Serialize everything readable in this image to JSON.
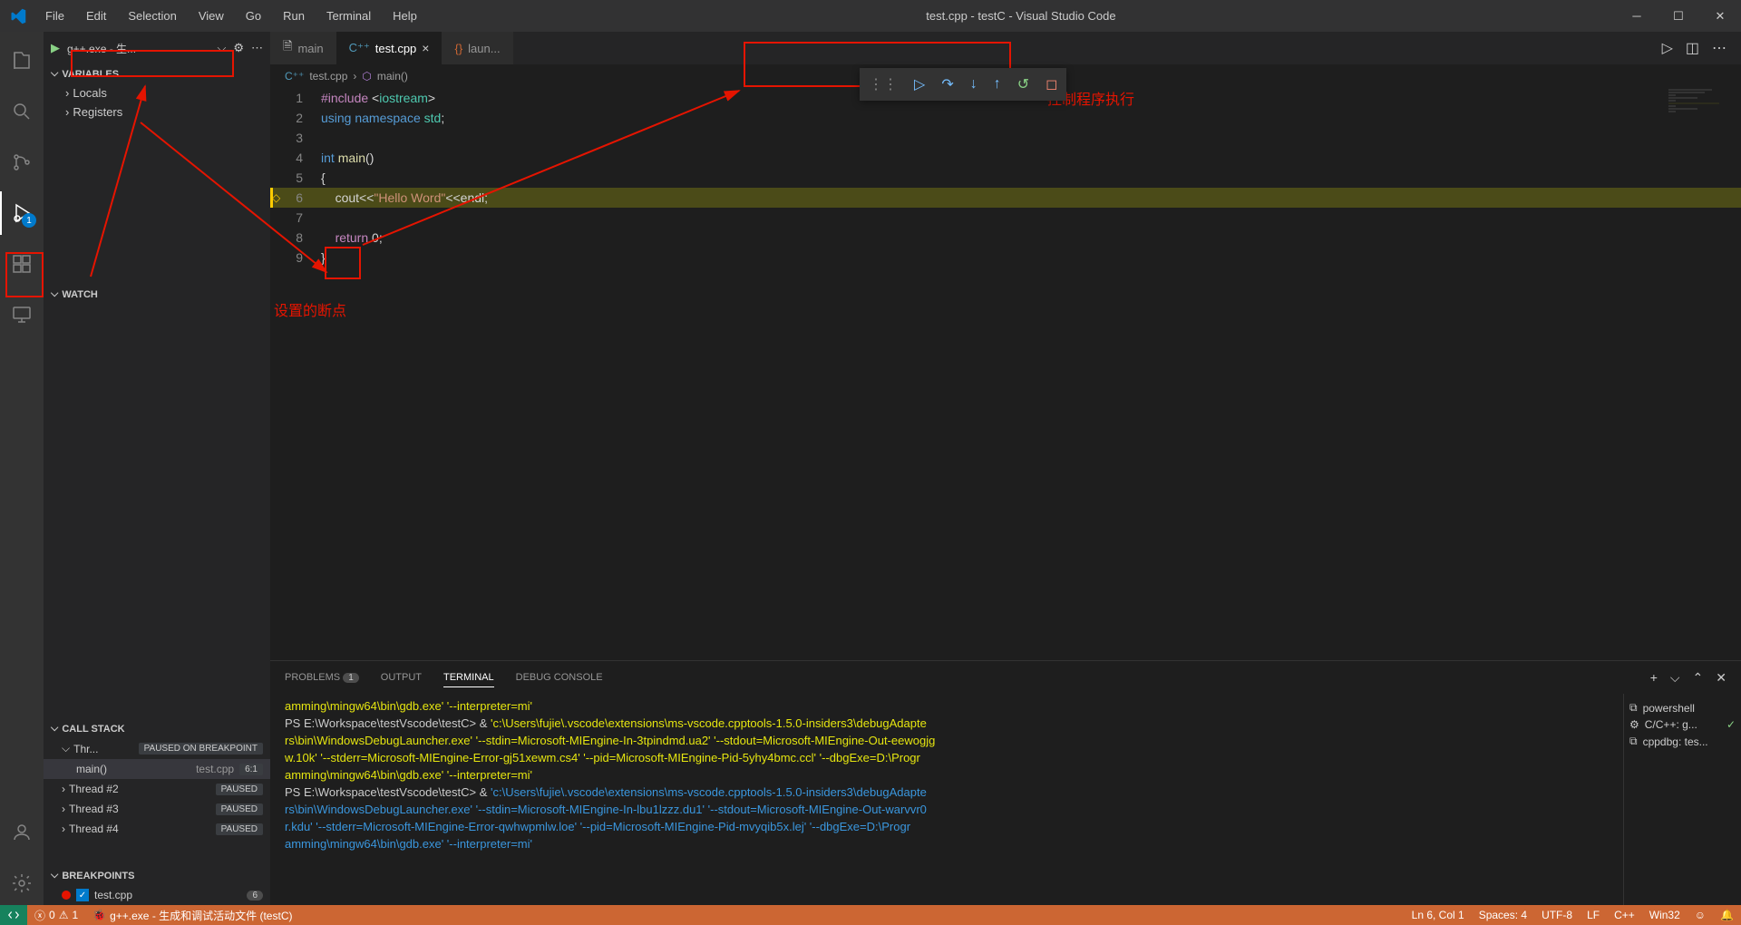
{
  "title": "test.cpp - testC - Visual Studio Code",
  "menu": [
    "File",
    "Edit",
    "Selection",
    "View",
    "Go",
    "Run",
    "Terminal",
    "Help"
  ],
  "runConfig": "g++.exe - 生...",
  "sidebar": {
    "variables": {
      "header": "VARIABLES",
      "items": [
        "Locals",
        "Registers"
      ]
    },
    "watch": {
      "header": "WATCH"
    },
    "callstack": {
      "header": "CALL STACK",
      "threadMain": "Thr...",
      "pausedOn": "PAUSED ON BREAKPOINT",
      "frame": {
        "fn": "main()",
        "file": "test.cpp",
        "pos": "6:1"
      },
      "threads": [
        {
          "name": "Thread #2",
          "state": "PAUSED"
        },
        {
          "name": "Thread #3",
          "state": "PAUSED"
        },
        {
          "name": "Thread #4",
          "state": "PAUSED"
        }
      ]
    },
    "breakpoints": {
      "header": "BREAKPOINTS",
      "items": [
        {
          "file": "test.cpp",
          "count": "6"
        }
      ]
    }
  },
  "tabs": [
    {
      "label": "main",
      "active": false
    },
    {
      "label": "test.cpp",
      "active": true
    },
    {
      "label": "laun...",
      "active": false
    }
  ],
  "breadcrumb": {
    "file": "test.cpp",
    "symbol": "main()"
  },
  "code": {
    "lines": [
      {
        "n": "1",
        "html": "<span class='k-pink'>#include</span> <span class='k-white'>&lt;</span><span class='k-green'>iostream</span><span class='k-white'>&gt;</span>"
      },
      {
        "n": "2",
        "html": "<span class='k-blue'>using</span> <span class='k-blue'>namespace</span> <span class='k-green'>std</span><span class='k-white'>;</span>"
      },
      {
        "n": "3",
        "html": ""
      },
      {
        "n": "4",
        "html": "<span class='k-blue'>int</span> <span class='k-fn'>main</span><span class='k-white'>()</span>"
      },
      {
        "n": "5",
        "html": "<span class='k-white'>{</span>"
      },
      {
        "n": "6",
        "html": "    <span class='k-white'>cout&lt;&lt;</span><span class='k-str'>\"Hello Word\"</span><span class='k-white'>&lt;&lt;endl;</span>",
        "hl": true,
        "bp": true
      },
      {
        "n": "7",
        "html": ""
      },
      {
        "n": "8",
        "html": "    <span class='k-pink'>return</span> <span class='k-white'>0;</span>"
      },
      {
        "n": "9",
        "html": "<span class='k-white'>}</span>"
      }
    ]
  },
  "panel": {
    "tabs": {
      "problems": "PROBLEMS",
      "problemsCount": "1",
      "output": "OUTPUT",
      "terminal": "TERMINAL",
      "debug": "DEBUG CONSOLE"
    },
    "terminal": {
      "lines": [
        {
          "cls": "t-yellow",
          "text": "amming\\mingw64\\bin\\gdb.exe' '--interpreter=mi'"
        },
        {
          "cls": "t-white",
          "text": "PS E:\\Workspace\\testVscode\\testC>  & <span class='t-yellow'>'c:\\Users\\fujie\\.vscode\\extensions\\ms-vscode.cpptools-1.5.0-insiders3\\debugAdapte</span>"
        },
        {
          "cls": "t-yellow",
          "text": "rs\\bin\\WindowsDebugLauncher.exe' '--stdin=Microsoft-MIEngine-In-3tpindmd.ua2' '--stdout=Microsoft-MIEngine-Out-eewogjg"
        },
        {
          "cls": "t-yellow",
          "text": "w.10k' '--stderr=Microsoft-MIEngine-Error-gj51xewm.cs4' '--pid=Microsoft-MIEngine-Pid-5yhy4bmc.ccl' '--dbgExe=D:\\Progr"
        },
        {
          "cls": "t-yellow",
          "text": "amming\\mingw64\\bin\\gdb.exe' '--interpreter=mi'"
        },
        {
          "cls": "t-white",
          "text": "PS E:\\Workspace\\testVscode\\testC>  & <span class='t-cyan'>'c:\\Users\\fujie\\.vscode\\extensions\\ms-vscode.cpptools-1.5.0-insiders3\\debugAdapte</span>"
        },
        {
          "cls": "t-cyan",
          "text": "rs\\bin\\WindowsDebugLauncher.exe' '--stdin=Microsoft-MIEngine-In-lbu1lzzz.du1' '--stdout=Microsoft-MIEngine-Out-warvvr0"
        },
        {
          "cls": "t-cyan",
          "text": "r.kdu' '--stderr=Microsoft-MIEngine-Error-qwhwpmlw.loe' '--pid=Microsoft-MIEngine-Pid-mvyqib5x.lej' '--dbgExe=D:\\Progr"
        },
        {
          "cls": "t-cyan",
          "text": "amming\\mingw64\\bin\\gdb.exe' '--interpreter=mi'"
        }
      ],
      "side": [
        {
          "icon": "⧉",
          "label": "powershell"
        },
        {
          "icon": "⚙",
          "label": "C/C++: g...",
          "check": true
        },
        {
          "icon": "⧉",
          "label": "cppdbg: tes..."
        }
      ]
    }
  },
  "statusbar": {
    "errors": "0",
    "warnings": "1",
    "debug": "g++.exe - 生成和调试活动文件 (testC)",
    "pos": "Ln 6, Col 1",
    "spaces": "Spaces: 4",
    "enc": "UTF-8",
    "eol": "LF",
    "lang": "C++",
    "os": "Win32"
  },
  "annotations": {
    "breakpoint": "设置的断点",
    "debugControls": "控制程序执行"
  }
}
